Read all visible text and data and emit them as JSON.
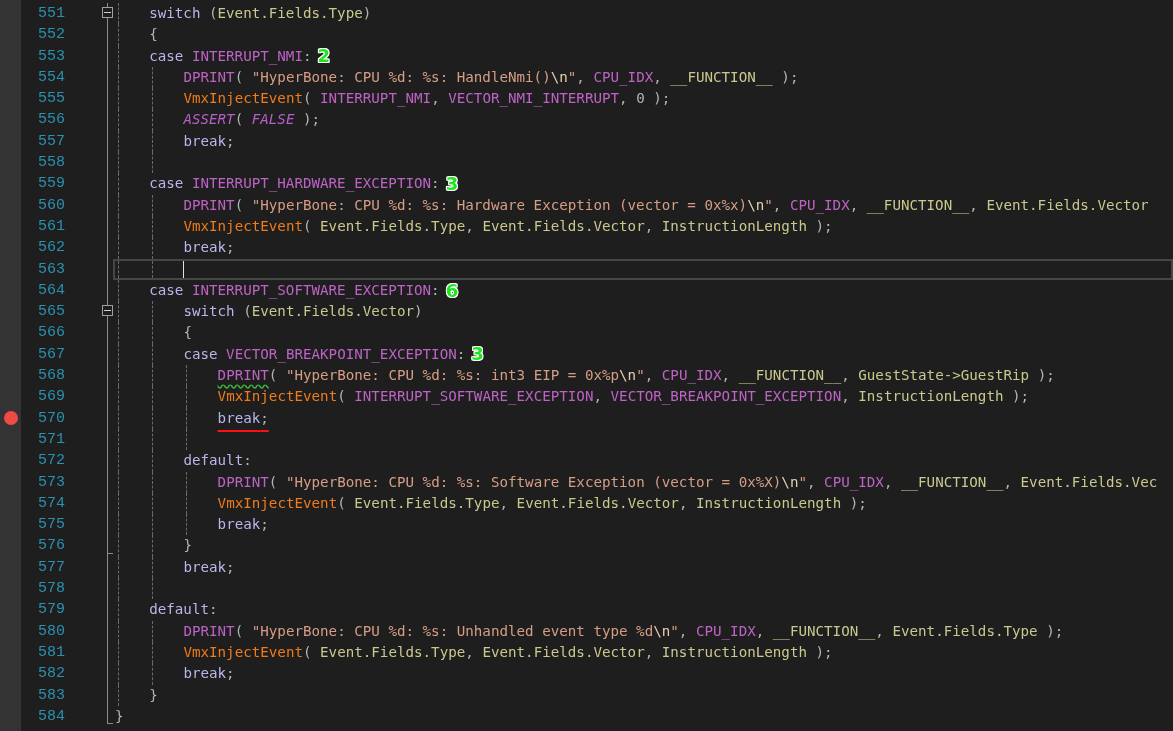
{
  "code": [
    {
      "kind": "block",
      "children": [
        {
          "kind": "line",
          "number": "551",
          "fold_open": true,
          "tokens": [
            {
              "kind": "kw",
              "text": "switch"
            },
            {
              "kind": "punct",
              "text": " ("
            },
            {
              "kind": "id",
              "text": "Event.Fields.Type"
            },
            {
              "kind": "punct",
              "text": ")"
            }
          ]
        },
        {
          "kind": "line",
          "number": "552",
          "tokens": [
            {
              "kind": "punct",
              "text": "{"
            }
          ]
        },
        {
          "kind": "line",
          "number": "553",
          "badge": "2",
          "tokens": [
            {
              "kind": "kw",
              "text": "case "
            },
            {
              "kind": "macro",
              "text": "INTERRUPT_NMI"
            },
            {
              "kind": "punct",
              "text": ":"
            }
          ]
        },
        {
          "kind": "block",
          "children": [
            {
              "kind": "line",
              "number": "554",
              "tokens": [
                {
                  "kind": "macro",
                  "text": "DPRINT"
                },
                {
                  "kind": "punct",
                  "text": "( "
                },
                {
                  "kind": "str",
                  "text": "\"HyperBone: CPU %d: %s: HandleNmi()"
                },
                {
                  "kind": "esc",
                  "text": "\\n"
                },
                {
                  "kind": "str",
                  "text": "\""
                },
                {
                  "kind": "punct",
                  "text": ", "
                },
                {
                  "kind": "macro",
                  "text": "CPU_IDX"
                },
                {
                  "kind": "punct",
                  "text": ", "
                },
                {
                  "kind": "id",
                  "text": "__FUNCTION__"
                },
                {
                  "kind": "punct",
                  "text": " );"
                }
              ]
            },
            {
              "kind": "line",
              "number": "555",
              "tokens": [
                {
                  "kind": "fn",
                  "text": "VmxInjectEvent"
                },
                {
                  "kind": "punct",
                  "text": "( "
                },
                {
                  "kind": "macro",
                  "text": "INTERRUPT_NMI"
                },
                {
                  "kind": "punct",
                  "text": ", "
                },
                {
                  "kind": "macro",
                  "text": "VECTOR_NMI_INTERRUPT"
                },
                {
                  "kind": "punct",
                  "text": ", 0 );"
                }
              ]
            },
            {
              "kind": "line",
              "number": "556",
              "tokens": [
                {
                  "kind": "imacro",
                  "text": "ASSERT"
                },
                {
                  "kind": "punct",
                  "text": "( "
                },
                {
                  "kind": "imacro",
                  "text": "FALSE"
                },
                {
                  "kind": "punct",
                  "text": " );"
                }
              ]
            },
            {
              "kind": "line",
              "number": "557",
              "tokens": [
                {
                  "kind": "kw",
                  "text": "break"
                },
                {
                  "kind": "punct",
                  "text": ";"
                }
              ]
            },
            {
              "kind": "line",
              "number": "558"
            }
          ]
        },
        {
          "kind": "line",
          "number": "559",
          "badge": "3",
          "tokens": [
            {
              "kind": "kw",
              "text": "case "
            },
            {
              "kind": "macro",
              "text": "INTERRUPT_HARDWARE_EXCEPTION"
            },
            {
              "kind": "punct",
              "text": ":"
            }
          ]
        },
        {
          "kind": "block",
          "children": [
            {
              "kind": "line",
              "number": "560",
              "tokens": [
                {
                  "kind": "macro",
                  "text": "DPRINT"
                },
                {
                  "kind": "punct",
                  "text": "( "
                },
                {
                  "kind": "str",
                  "text": "\"HyperBone: CPU %d: %s: Hardware Exception (vector = 0x%x)"
                },
                {
                  "kind": "esc",
                  "text": "\\n"
                },
                {
                  "kind": "str",
                  "text": "\""
                },
                {
                  "kind": "punct",
                  "text": ", "
                },
                {
                  "kind": "macro",
                  "text": "CPU_IDX"
                },
                {
                  "kind": "punct",
                  "text": ", "
                },
                {
                  "kind": "id",
                  "text": "__FUNCTION__"
                },
                {
                  "kind": "punct",
                  "text": ", "
                },
                {
                  "kind": "id",
                  "text": "Event.Fields.Vector"
                }
              ]
            },
            {
              "kind": "line",
              "number": "561",
              "tokens": [
                {
                  "kind": "fn",
                  "text": "VmxInjectEvent"
                },
                {
                  "kind": "punct",
                  "text": "( "
                },
                {
                  "kind": "id",
                  "text": "Event.Fields.Type"
                },
                {
                  "kind": "punct",
                  "text": ", "
                },
                {
                  "kind": "id",
                  "text": "Event.Fields.Vector"
                },
                {
                  "kind": "punct",
                  "text": ", "
                },
                {
                  "kind": "id",
                  "text": "InstructionLength"
                },
                {
                  "kind": "punct",
                  "text": " );"
                }
              ]
            },
            {
              "kind": "line",
              "number": "562",
              "tokens": [
                {
                  "kind": "kw",
                  "text": "break"
                },
                {
                  "kind": "punct",
                  "text": ";"
                }
              ]
            },
            {
              "kind": "line",
              "number": "563",
              "current": true
            }
          ]
        },
        {
          "kind": "line",
          "number": "564",
          "badge": "6",
          "tokens": [
            {
              "kind": "kw",
              "text": "case "
            },
            {
              "kind": "macro",
              "text": "INTERRUPT_SOFTWARE_EXCEPTION"
            },
            {
              "kind": "punct",
              "text": ":"
            }
          ]
        },
        {
          "kind": "block",
          "children": [
            {
              "kind": "line",
              "number": "565",
              "fold_open": true,
              "tokens": [
                {
                  "kind": "kw",
                  "text": "switch"
                },
                {
                  "kind": "punct",
                  "text": " ("
                },
                {
                  "kind": "id",
                  "text": "Event.Fields.Vector"
                },
                {
                  "kind": "punct",
                  "text": ")"
                }
              ]
            },
            {
              "kind": "line",
              "number": "566",
              "tokens": [
                {
                  "kind": "punct",
                  "text": "{"
                }
              ]
            },
            {
              "kind": "line",
              "number": "567",
              "badge": "3",
              "tokens": [
                {
                  "kind": "kw",
                  "text": "case "
                },
                {
                  "kind": "macro",
                  "text": "VECTOR_BREAKPOINT_EXCEPTION"
                },
                {
                  "kind": "punct",
                  "text": ":"
                }
              ]
            },
            {
              "kind": "block",
              "children": [
                {
                  "kind": "line",
                  "number": "568",
                  "tokens": [
                    {
                      "kind": "macro",
                      "text": "DPRINT",
                      "squiggle": true
                    },
                    {
                      "kind": "punct",
                      "text": "( "
                    },
                    {
                      "kind": "str",
                      "text": "\"HyperBone: CPU %d: %s: int3 EIP = 0x%p"
                    },
                    {
                      "kind": "esc",
                      "text": "\\n"
                    },
                    {
                      "kind": "str",
                      "text": "\""
                    },
                    {
                      "kind": "punct",
                      "text": ", "
                    },
                    {
                      "kind": "macro",
                      "text": "CPU_IDX"
                    },
                    {
                      "kind": "punct",
                      "text": ", "
                    },
                    {
                      "kind": "id",
                      "text": "__FUNCTION__"
                    },
                    {
                      "kind": "punct",
                      "text": ", "
                    },
                    {
                      "kind": "id",
                      "text": "GuestState->GuestRip"
                    },
                    {
                      "kind": "punct",
                      "text": " );"
                    }
                  ]
                },
                {
                  "kind": "line",
                  "number": "569",
                  "tokens": [
                    {
                      "kind": "fn",
                      "text": "VmxInjectEvent"
                    },
                    {
                      "kind": "punct",
                      "text": "( "
                    },
                    {
                      "kind": "macro",
                      "text": "INTERRUPT_SOFTWARE_EXCEPTION"
                    },
                    {
                      "kind": "punct",
                      "text": ", "
                    },
                    {
                      "kind": "macro",
                      "text": "VECTOR_BREAKPOINT_EXCEPTION"
                    },
                    {
                      "kind": "punct",
                      "text": ", "
                    },
                    {
                      "kind": "id",
                      "text": "InstructionLength"
                    },
                    {
                      "kind": "punct",
                      "text": " );"
                    }
                  ]
                },
                {
                  "kind": "line",
                  "number": "570",
                  "breakpoint": true,
                  "underlined": true,
                  "tokens": [
                    {
                      "kind": "kw",
                      "text": "break"
                    },
                    {
                      "kind": "punct",
                      "text": ";"
                    }
                  ]
                },
                {
                  "kind": "line",
                  "number": "571"
                }
              ]
            },
            {
              "kind": "line",
              "number": "572",
              "tokens": [
                {
                  "kind": "kw",
                  "text": "default"
                },
                {
                  "kind": "punct",
                  "text": ":"
                }
              ]
            },
            {
              "kind": "block",
              "children": [
                {
                  "kind": "line",
                  "number": "573",
                  "tokens": [
                    {
                      "kind": "macro",
                      "text": "DPRINT"
                    },
                    {
                      "kind": "punct",
                      "text": "( "
                    },
                    {
                      "kind": "str",
                      "text": "\"HyperBone: CPU %d: %s: Software Exception (vector = 0x%X)"
                    },
                    {
                      "kind": "esc",
                      "text": "\\n"
                    },
                    {
                      "kind": "str",
                      "text": "\""
                    },
                    {
                      "kind": "punct",
                      "text": ", "
                    },
                    {
                      "kind": "macro",
                      "text": "CPU_IDX"
                    },
                    {
                      "kind": "punct",
                      "text": ", "
                    },
                    {
                      "kind": "id",
                      "text": "__FUNCTION__"
                    },
                    {
                      "kind": "punct",
                      "text": ", "
                    },
                    {
                      "kind": "id",
                      "text": "Event.Fields.Vec"
                    }
                  ]
                },
                {
                  "kind": "line",
                  "number": "574",
                  "tokens": [
                    {
                      "kind": "fn",
                      "text": "VmxInjectEvent"
                    },
                    {
                      "kind": "punct",
                      "text": "( "
                    },
                    {
                      "kind": "id",
                      "text": "Event.Fields.Type"
                    },
                    {
                      "kind": "punct",
                      "text": ", "
                    },
                    {
                      "kind": "id",
                      "text": "Event.Fields.Vector"
                    },
                    {
                      "kind": "punct",
                      "text": ", "
                    },
                    {
                      "kind": "id",
                      "text": "InstructionLength"
                    },
                    {
                      "kind": "punct",
                      "text": " );"
                    }
                  ]
                },
                {
                  "kind": "line",
                  "number": "575",
                  "tokens": [
                    {
                      "kind": "kw",
                      "text": "break"
                    },
                    {
                      "kind": "punct",
                      "text": ";"
                    }
                  ]
                }
              ]
            },
            {
              "kind": "line",
              "number": "576",
              "fold_end": true,
              "tokens": [
                {
                  "kind": "punct",
                  "text": "}"
                }
              ]
            },
            {
              "kind": "line",
              "number": "577",
              "tokens": [
                {
                  "kind": "kw",
                  "text": "break"
                },
                {
                  "kind": "punct",
                  "text": ";"
                }
              ]
            },
            {
              "kind": "line",
              "number": "578"
            }
          ]
        },
        {
          "kind": "line",
          "number": "579",
          "tokens": [
            {
              "kind": "kw",
              "text": "default"
            },
            {
              "kind": "punct",
              "text": ":"
            }
          ]
        },
        {
          "kind": "block",
          "children": [
            {
              "kind": "line",
              "number": "580",
              "tokens": [
                {
                  "kind": "macro",
                  "text": "DPRINT"
                },
                {
                  "kind": "punct",
                  "text": "( "
                },
                {
                  "kind": "str",
                  "text": "\"HyperBone: CPU %d: %s: Unhandled event type %d"
                },
                {
                  "kind": "esc",
                  "text": "\\n"
                },
                {
                  "kind": "str",
                  "text": "\""
                },
                {
                  "kind": "punct",
                  "text": ", "
                },
                {
                  "kind": "macro",
                  "text": "CPU_IDX"
                },
                {
                  "kind": "punct",
                  "text": ", "
                },
                {
                  "kind": "id",
                  "text": "__FUNCTION__"
                },
                {
                  "kind": "punct",
                  "text": ", "
                },
                {
                  "kind": "id",
                  "text": "Event.Fields.Type"
                },
                {
                  "kind": "punct",
                  "text": " );"
                }
              ]
            },
            {
              "kind": "line",
              "number": "581",
              "tokens": [
                {
                  "kind": "fn",
                  "text": "VmxInjectEvent"
                },
                {
                  "kind": "punct",
                  "text": "( "
                },
                {
                  "kind": "id",
                  "text": "Event.Fields.Type"
                },
                {
                  "kind": "punct",
                  "text": ", "
                },
                {
                  "kind": "id",
                  "text": "Event.Fields.Vector"
                },
                {
                  "kind": "punct",
                  "text": ", "
                },
                {
                  "kind": "id",
                  "text": "InstructionLength"
                },
                {
                  "kind": "punct",
                  "text": " );"
                }
              ]
            },
            {
              "kind": "line",
              "number": "582",
              "tokens": [
                {
                  "kind": "kw",
                  "text": "break"
                },
                {
                  "kind": "punct",
                  "text": ";"
                }
              ]
            }
          ]
        },
        {
          "kind": "line",
          "number": "583",
          "tokens": [
            {
              "kind": "punct",
              "text": "}"
            }
          ]
        }
      ]
    },
    {
      "kind": "line",
      "number": "584",
      "fold_end": true,
      "tokens": [
        {
          "kind": "punct",
          "text": "}"
        }
      ]
    }
  ]
}
